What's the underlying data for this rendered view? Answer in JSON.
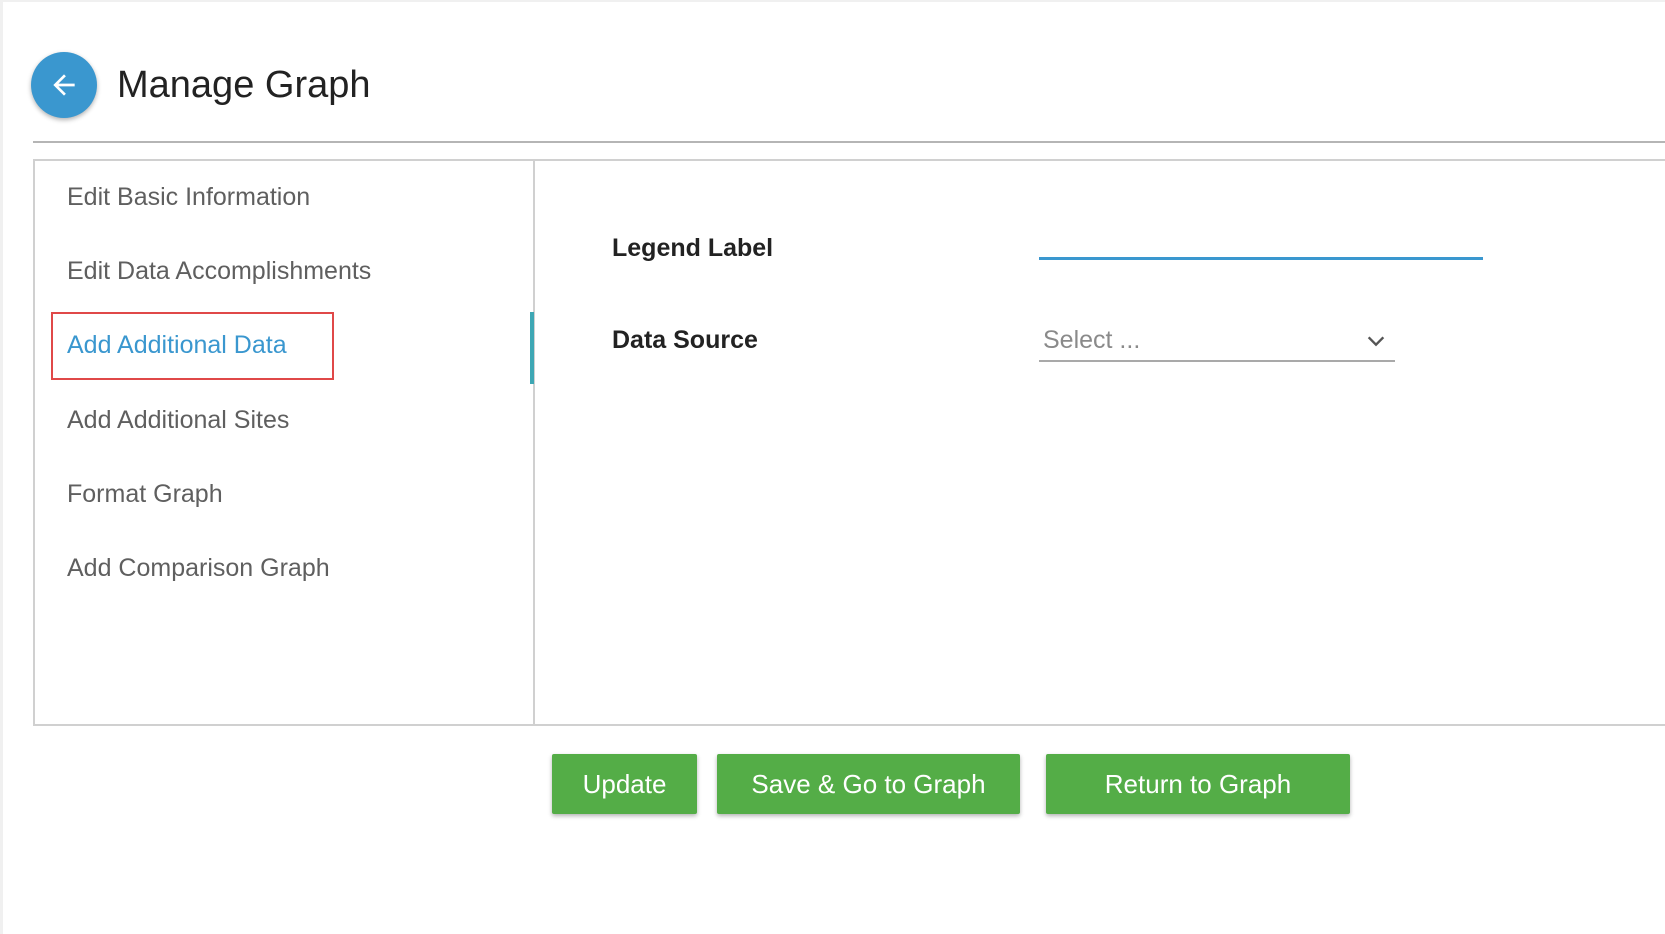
{
  "header": {
    "title": "Manage Graph",
    "back_icon": "arrow-left-icon"
  },
  "sidebar": {
    "items": [
      {
        "label": "Edit Basic Information",
        "active": false
      },
      {
        "label": "Edit Data Accomplishments",
        "active": false
      },
      {
        "label": "Add Additional Data",
        "active": true
      },
      {
        "label": "Add Additional Sites",
        "active": false
      },
      {
        "label": "Format Graph",
        "active": false
      },
      {
        "label": "Add Comparison Graph",
        "active": false
      }
    ]
  },
  "form": {
    "legend_label": {
      "label": "Legend Label",
      "value": ""
    },
    "data_source": {
      "label": "Data Source",
      "value": "Select ...",
      "icon": "chevron-down-icon"
    }
  },
  "buttons": {
    "update": "Update",
    "save_go": "Save & Go to Graph",
    "return": "Return to Graph"
  },
  "colors": {
    "accent": "#3a97cf",
    "button_green": "#54ad47",
    "highlight_red": "#e04848",
    "active_indicator": "#3ea7b4"
  }
}
